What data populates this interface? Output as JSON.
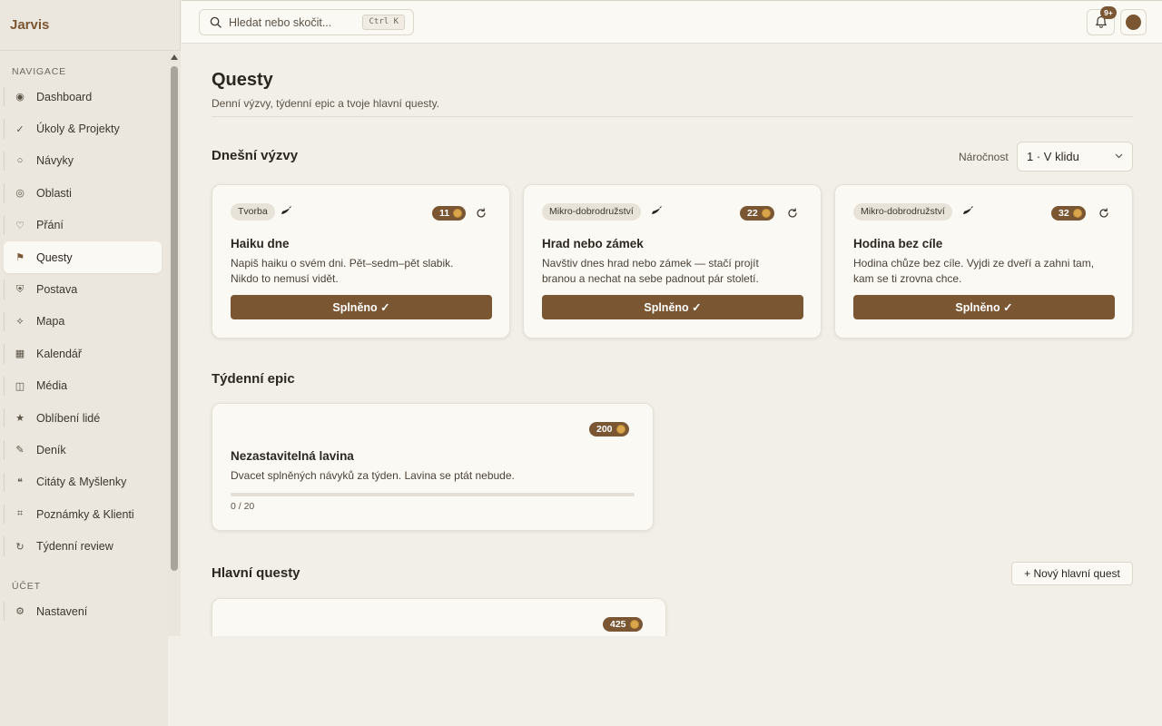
{
  "brand": "Jarvis",
  "sidebar": {
    "nav_label": "NAVIGACE",
    "items": [
      {
        "label": "Dashboard",
        "icon": "◉"
      },
      {
        "label": "Úkoly & Projekty",
        "icon": "✓"
      },
      {
        "label": "Návyky",
        "icon": "○"
      },
      {
        "label": "Oblasti",
        "icon": "◎"
      },
      {
        "label": "Přání",
        "icon": "♡"
      },
      {
        "label": "Questy",
        "icon": "⚑",
        "active": true
      },
      {
        "label": "Postava",
        "icon": "⛨"
      },
      {
        "label": "Mapa",
        "icon": "⟡"
      },
      {
        "label": "Kalendář",
        "icon": "▦"
      },
      {
        "label": "Média",
        "icon": "◫"
      },
      {
        "label": "Oblíbení lidé",
        "icon": "★"
      },
      {
        "label": "Deník",
        "icon": "✎"
      },
      {
        "label": "Citáty & Myšlenky",
        "icon": "❝"
      },
      {
        "label": "Poznámky & Klienti",
        "icon": "⌗"
      },
      {
        "label": "Týdenní review",
        "icon": "↻"
      }
    ],
    "account_label": "ÚČET",
    "account_items": [
      {
        "label": "Nastavení",
        "icon": "⚙"
      }
    ]
  },
  "topbar": {
    "search_placeholder": "Hledat nebo skočit...",
    "shortcut": "Ctrl K",
    "notification_count": "9+"
  },
  "page": {
    "title": "Questy",
    "subtitle": "Denní výzvy, týdenní epic a tvoje hlavní questy."
  },
  "daily": {
    "title": "Dnešní výzvy",
    "difficulty_label": "Náročnost",
    "difficulty_value": "1 · V klidu",
    "cards": [
      {
        "tag": "Tvorba",
        "xp": "11",
        "title": "Haiku dne",
        "desc_line1": "Napiš haiku o svém dni. Pět–sedm–pět slabik.",
        "desc_line2": "Nikdo to nemusí vidět.",
        "button": "Splněno ✓"
      },
      {
        "tag": "Mikro-dobrodružství",
        "xp": "22",
        "title": "Hrad nebo zámek",
        "desc_line1": "Navštiv dnes hrad nebo zámek — stačí projít",
        "desc_line2": "branou a nechat na sebe padnout pár století.",
        "button": "Splněno ✓"
      },
      {
        "tag": "Mikro-dobrodružství",
        "xp": "32",
        "title": "Hodina bez cíle",
        "desc_line1": "Hodina chůze bez cíle. Vyjdi ze dveří a zahni tam,",
        "desc_line2": "kam se ti zrovna chce.",
        "button": "Splněno ✓"
      }
    ]
  },
  "weekly": {
    "title": "Týdenní epic",
    "xp": "200",
    "quest_title": "Nezastavitelná lavina",
    "desc": "Dvacet splněných návyků za týden. Lavina se ptát nebude.",
    "progress_value": 0,
    "progress_max": 20,
    "progress_text": "0 / 20"
  },
  "main_quests": {
    "title": "Hlavní questy",
    "new_button": "+ Nový hlavní quest",
    "first_xp": "425"
  },
  "colors": {
    "accent": "#7a5633",
    "coin": "#d9a64c",
    "background": "#f2efe8",
    "card": "#fbf9f4"
  }
}
